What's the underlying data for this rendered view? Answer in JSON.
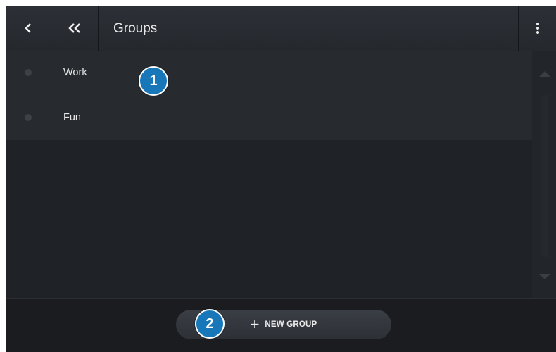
{
  "header": {
    "title": "Groups",
    "back_icon": "chevron-left-icon",
    "home_icon": "double-chevron-left-icon",
    "menu_icon": "kebab-menu-icon"
  },
  "list": {
    "items": [
      {
        "label": "Work"
      },
      {
        "label": "Fun"
      }
    ]
  },
  "footer": {
    "new_group_plus": "+",
    "new_group_label": "NEW GROUP"
  },
  "callouts": [
    "1",
    "2"
  ],
  "colors": {
    "background": "#1d2025",
    "row": "#272a2f",
    "badge": "#1777b8",
    "text": "#e8e8e8"
  }
}
